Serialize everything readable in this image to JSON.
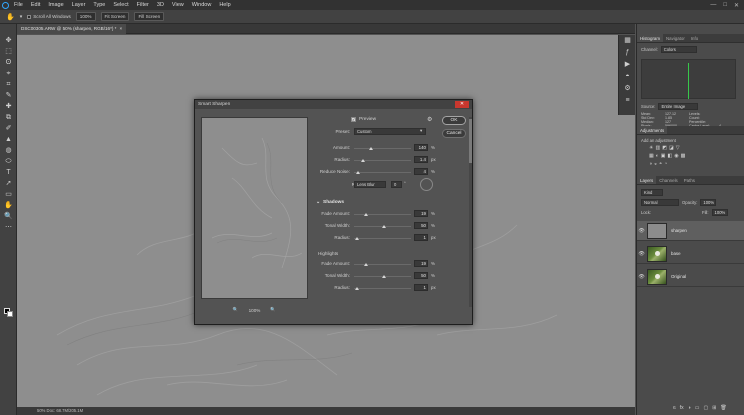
{
  "menu": {
    "items": [
      "File",
      "Edit",
      "Image",
      "Layer",
      "Type",
      "Select",
      "Filter",
      "3D",
      "View",
      "Window",
      "Help"
    ],
    "window_controls": [
      "—",
      "□",
      "✕"
    ]
  },
  "options": {
    "scroll_all_label": "Scroll All Windows",
    "zoom_value": "100%",
    "fit_screen_label": "Fit Screen",
    "fill_screen_label": "Fill Screen"
  },
  "document": {
    "tab_title": "DSC00305.ARW @ 50% (sharpen, RGB/16*) *",
    "tab_close": "×",
    "status": "50%   Doc: 68.7M/205.1M"
  },
  "dialog": {
    "title": "Smart Sharpen",
    "close": "✕",
    "ok_label": "OK",
    "cancel_label": "Cancel",
    "preview_label": "Preview",
    "preset_label": "Preset:",
    "preset_value": "Custom",
    "zoom_level": "100%",
    "zoom_out": "🔍",
    "zoom_in": "🔍",
    "remove_label": "Remove:",
    "remove_value": "Lens Blur",
    "angle_value": "0",
    "angle_unit": "°",
    "main": [
      {
        "label": "Amount:",
        "value": "140",
        "unit": "%",
        "level": 0.28
      },
      {
        "label": "Radius:",
        "value": "1.4",
        "unit": "px",
        "level": 0.12
      },
      {
        "label": "Reduce Noise:",
        "value": "4",
        "unit": "%",
        "level": 0.04
      }
    ],
    "shadows_title": "Shadows",
    "shadows": [
      {
        "label": "Fade Amount:",
        "value": "19",
        "unit": "%",
        "level": 0.19
      },
      {
        "label": "Tonal Width:",
        "value": "50",
        "unit": "%",
        "level": 0.5
      },
      {
        "label": "Radius:",
        "value": "1",
        "unit": "px",
        "level": 0.01
      }
    ],
    "highlights_title": "Highlights",
    "highlights": [
      {
        "label": "Fade Amount:",
        "value": "19",
        "unit": "%",
        "level": 0.19
      },
      {
        "label": "Tonal Width:",
        "value": "50",
        "unit": "%",
        "level": 0.5
      },
      {
        "label": "Radius:",
        "value": "1",
        "unit": "px",
        "level": 0.01
      }
    ]
  },
  "panels": {
    "histogram_tabs": [
      "Histogram",
      "Navigator",
      "Info"
    ],
    "channel_label": "Channel:",
    "channel_value": "Colors",
    "source_label": "Source:",
    "source_value": "Entire Image",
    "stats": [
      [
        "Mean:",
        "127.12",
        "Levels:",
        ""
      ],
      [
        "Std Dev:",
        "1.85",
        "Count:",
        ""
      ],
      [
        "Median:",
        "127",
        "Percentile:",
        ""
      ],
      [
        "Pixels:",
        "596000",
        "Cache Level:",
        "4"
      ]
    ],
    "adjustments_title": "Adjustments",
    "add_adjustment": "Add an adjustment",
    "adj_row1": [
      "☀",
      "▥",
      "◩",
      "◪",
      "▽"
    ],
    "adj_row2": [
      "▦",
      "◐",
      "▣",
      "◧",
      "◉",
      "▩"
    ],
    "adj_row3": [
      "◑",
      "◒",
      "◓",
      "◔"
    ],
    "layers_tabs": [
      "Layers",
      "Channels",
      "Paths"
    ],
    "kind_label": "Kind",
    "blend_mode": "Normal",
    "opacity_label": "Opacity:",
    "opacity_value": "100%",
    "lock_label": "Lock:",
    "fill_label": "Fill:",
    "fill_value": "100%",
    "layers": [
      {
        "name": "sharpen",
        "eye": "👁"
      },
      {
        "name": "base",
        "eye": "👁"
      },
      {
        "name": "Original",
        "eye": "👁"
      }
    ],
    "bottom_icons": [
      "ɢ",
      "fx",
      "◑",
      "▭",
      "▢",
      "⊞",
      "🗑"
    ]
  },
  "tools": [
    "✥",
    "⬚",
    "ʘ",
    "⌖",
    "⌗",
    "✎",
    "✚",
    "⧉",
    "✐",
    "▲",
    "◍",
    "⬭",
    "T",
    "➚",
    "▭",
    "✋",
    "🔍",
    "⋯"
  ],
  "mini_strip": [
    "▦",
    "ƒ",
    "▶",
    "◓",
    "⚙",
    "≡"
  ]
}
